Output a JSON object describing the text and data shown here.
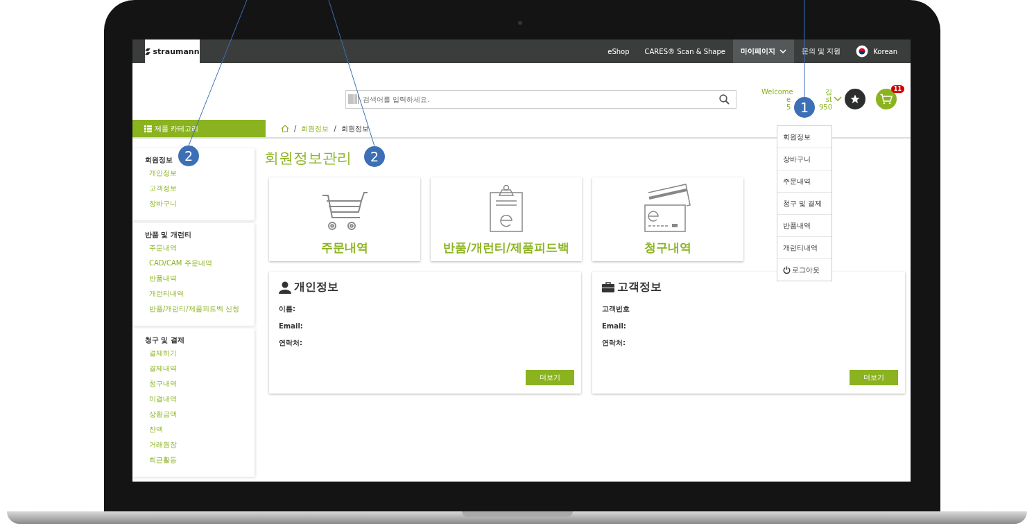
{
  "top_nav": {
    "logo": "straumann",
    "items": [
      {
        "label": "eShop",
        "selected": false
      },
      {
        "label": "CARES® Scan & Shape",
        "selected": false
      },
      {
        "label": "마이페이지",
        "selected": true,
        "kind": "dropdown"
      },
      {
        "label": "문의 및 지원",
        "selected": false
      }
    ],
    "language": "Korean"
  },
  "search": {
    "placeholder": "검색어를 입력하세요."
  },
  "account": {
    "welcome_fragments": [
      [
        "Welcome",
        "김"
      ],
      [
        "e",
        "st"
      ],
      [
        "5",
        "950"
      ]
    ],
    "cart_count": "11"
  },
  "category_button": "제품 카테고리",
  "breadcrumb": [
    {
      "separator": "/",
      "label": "회원정보"
    },
    {
      "separator": "/",
      "label": "회원정보"
    }
  ],
  "sidebar": [
    {
      "title": "회원정보",
      "items": [
        "개인정보",
        "고객정보",
        "장바구니"
      ]
    },
    {
      "title": "반품 및 개런티",
      "items": [
        "주문내역",
        "CAD/CAM 주문내역",
        "반품내역",
        "개런티내역",
        "반품/개런티/제품피드백 신청"
      ]
    },
    {
      "title": "청구 및 결제",
      "items": [
        "결제하기",
        "결제내역",
        "청구내역",
        "미결내역",
        "상환금액",
        "잔액",
        "거래원장",
        "최근활동"
      ]
    }
  ],
  "page_title": "회원정보관리",
  "tiles": [
    {
      "kind": "cart",
      "label": "주문내역"
    },
    {
      "kind": "clipboard",
      "label": "반품/개런티/제품피드백"
    },
    {
      "kind": "card",
      "label": "청구내역"
    }
  ],
  "info_cards": [
    {
      "kind": "person",
      "title": "개인정보",
      "fields": [
        "이름:",
        "Email:",
        "연락처:"
      ],
      "button": "더보기"
    },
    {
      "kind": "briefcase",
      "title": "고객정보",
      "fields": [
        "고객번호",
        "Email:",
        "연락처:"
      ],
      "button": "더보기"
    }
  ],
  "account_menu": [
    {
      "label": "회원정보",
      "kind": "link"
    },
    {
      "label": "장바구니",
      "kind": "link"
    },
    {
      "label": "주문내역",
      "kind": "link"
    },
    {
      "label": "청구 및 결제",
      "kind": "link"
    },
    {
      "label": "반품내역",
      "kind": "link"
    },
    {
      "label": "개런티내역",
      "kind": "link"
    },
    {
      "label": "로그아웃",
      "kind": "logout"
    }
  ],
  "callouts": [
    {
      "label": "1"
    },
    {
      "label": "2"
    },
    {
      "label": "2"
    }
  ]
}
